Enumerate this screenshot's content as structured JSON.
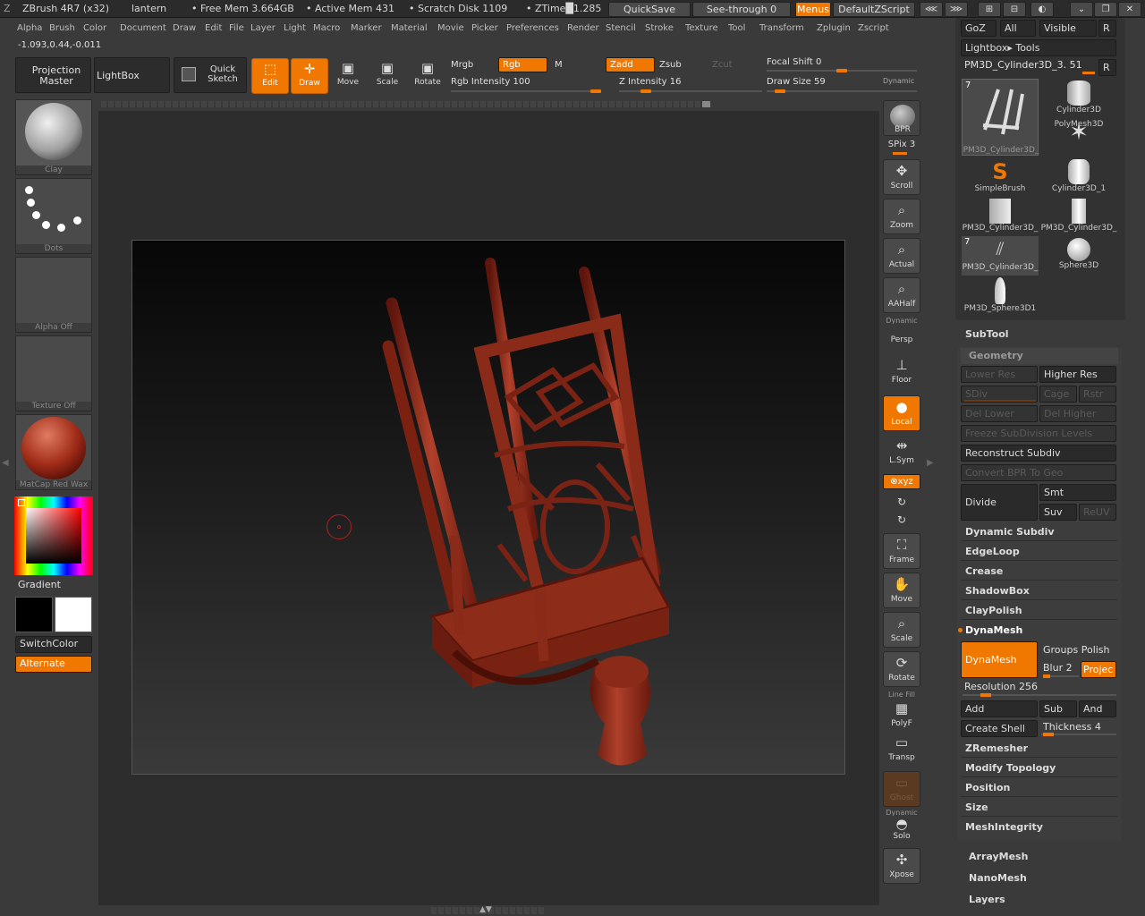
{
  "titlebar": {
    "app": "ZBrush 4R7 (x32)",
    "doc": "lantern",
    "free_mem": "• Free Mem 3.664GB",
    "active_mem": "• Active Mem 431",
    "scratch": "• Scratch Disk 1109",
    "ztime": "• ZTime█1.285",
    "quicksave": "QuickSave",
    "see_through": "See-through  0",
    "menus": "Menus",
    "script": "DefaultZScript"
  },
  "menus": [
    "Alpha",
    "Brush",
    "Color",
    "Document",
    "Draw",
    "Edit",
    "File",
    "Layer",
    "Light",
    "Macro",
    "Marker",
    "Material",
    "Movie",
    "Picker",
    "Preferences",
    "Render",
    "Stencil",
    "Stroke",
    "Texture",
    "Tool",
    "Transform",
    "Zplugin",
    "Zscript"
  ],
  "coords": "-1.093,0.44,-0.011",
  "top_shelf": {
    "projection_master": "Projection Master",
    "lightbox": "LightBox",
    "quick_sketch": "Quick Sketch",
    "edit": "Edit",
    "draw": "Draw",
    "move": "Move",
    "scale": "Scale",
    "rotate": "Rotate",
    "mrgb": "Mrgb",
    "rgb": "Rgb",
    "m": "M",
    "zadd": "Zadd",
    "zsub": "Zsub",
    "zcut": "Zcut",
    "rgb_intensity": "Rgb Intensity 100",
    "z_intensity": "Z Intensity 16",
    "focal_shift": "Focal Shift 0",
    "draw_size": "Draw Size 59",
    "dynamic": "Dynamic",
    "rgb_intensity_level": 1.0,
    "z_intensity_level": 0.16,
    "focal_shift_level": 0.5,
    "draw_size_level": 0.06
  },
  "left_shelf": {
    "brush": "Clay",
    "stroke": "Dots",
    "alpha": "Alpha  Off",
    "texture": "Texture  Off",
    "material": "MatCap  Red  Wax",
    "gradient": "Gradient",
    "switch_color": "SwitchColor",
    "alternate": "Alternate"
  },
  "right_shelf": {
    "bpr": "BPR",
    "spix": "SPix 3",
    "scroll": "Scroll",
    "zoom": "Zoom",
    "actual": "Actual",
    "aahalf": "AAHalf",
    "dynamic": "Dynamic",
    "persp": "Persp",
    "floor": "Floor",
    "local": "Local",
    "lsym": "L.Sym",
    "xyz": "⊗xyz",
    "frame": "Frame",
    "move": "Move",
    "scale": "Scale",
    "rotate": "Rotate",
    "line_fill": "Line Fill",
    "polyf": "PolyF",
    "transp": "Transp",
    "ghost": "Ghost",
    "dynamic2": "Dynamic",
    "solo": "Solo",
    "xpose": "Xpose"
  },
  "tool_panel": {
    "goz": "GoZ",
    "all": "All",
    "visible": "Visible",
    "r": "R",
    "lightbox_tools": "Lightbox▸ Tools",
    "current_tool": "PM3D_Cylinder3D_3. 51",
    "tools": [
      {
        "name": "PM3D_Cylinder3D_",
        "badge": "7"
      },
      {
        "name": "Cylinder3D",
        "badge": ""
      },
      {
        "name": "PolyMesh3D",
        "badge": ""
      },
      {
        "name": "SimpleBrush",
        "badge": ""
      },
      {
        "name": "Cylinder3D_1",
        "badge": ""
      },
      {
        "name": "PM3D_Cylinder3D_",
        "badge": ""
      },
      {
        "name": "PM3D_Cylinder3D_",
        "badge": ""
      },
      {
        "name": "PM3D_Cylinder3D_",
        "badge": "7"
      },
      {
        "name": "Sphere3D",
        "badge": ""
      },
      {
        "name": "PM3D_Sphere3D1",
        "badge": ""
      }
    ],
    "subtool": "SubTool",
    "geometry": "Geometry",
    "lower_res": "Lower Res",
    "higher_res": "Higher Res",
    "sdiv": "SDiv",
    "cage": "Cage",
    "rstr": "Rstr",
    "del_lower": "Del Lower",
    "del_higher": "Del Higher",
    "freeze": "Freeze SubDivision Levels",
    "reconstruct": "Reconstruct Subdiv",
    "convert_bpr": "Convert BPR To Geo",
    "divide": "Divide",
    "smt": "Smt",
    "suv": "Suv",
    "reuv": "ReUV",
    "dynamic_subdiv": "Dynamic Subdiv",
    "edgeloop": "EdgeLoop",
    "crease": "Crease",
    "shadowbox": "ShadowBox",
    "claypolish": "ClayPolish",
    "dynamesh_header": "DynaMesh",
    "dynamesh_btn": "DynaMesh",
    "groups_polish": "Groups Polish",
    "blur": "Blur 2",
    "project": "Projec",
    "resolution": "Resolution 256",
    "add": "Add",
    "sub": "Sub",
    "and": "And",
    "create_shell": "Create Shell",
    "thickness": "Thickness 4",
    "zremesher": "ZRemesher",
    "modify_topology": "Modify Topology",
    "position": "Position",
    "size": "Size",
    "meshintegrity": "MeshIntegrity",
    "arraymesh": "ArrayMesh",
    "nanomesh": "NanoMesh",
    "layers": "Layers"
  },
  "colors": {
    "accent": "#f07800",
    "model": "#9a3020"
  }
}
